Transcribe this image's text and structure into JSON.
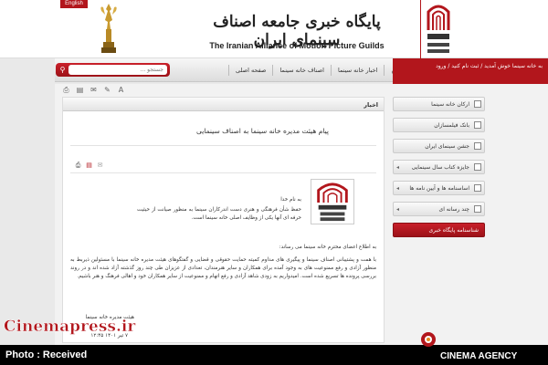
{
  "header": {
    "english_label": "English",
    "title_fa": "پایگاه خبری جامعه اصناف سینمای ایران",
    "title_en": "The Iranian Alliance of Motion Picture Guilds"
  },
  "nav": {
    "search_placeholder": "جستجو ...",
    "items": [
      "صفحه اصلی",
      "اصناف خانه سینما",
      "اخبار خانه سینما",
      "عکس"
    ],
    "welcome_text": "به خانه سینما خوش آمدید / ثبت نام کنید / ورود"
  },
  "content": {
    "section_label": "اخبار",
    "article_title": "پیام هیئت مدیره خانه سینما به اصناف سینمایی",
    "intro_heading": "به نام خدا",
    "intro_text": "حفظ شأن فرهنگی و هنری دست اندرکاران سینما به منظور صیانت از حیثیت حرفه ای آنها یکی از وظایف اصلی خانه سینما است.",
    "notice_heading": "به اطلاع اعضای محترم خانه سینما می رساند:",
    "body_text": "با همت و پشتیبانی اصناف سینما و پیگیری های مداوم کمیته حمایت حقوقی و قضایی و گفتگوهای هیئت مدیره خانه سینما با مسئولین ذیربط به منظور آزادی و رفع ممنوعیت های به وجود آمده برای همکاران و سایر هنرمندان، تعدادی از عزیزان طی چند روز گذشته آزاد شده اند و در روند بررسی پرونده ها تسریع شده است. امیدواریم به زودی شاهد آزادی و رفع اتهام و ممنوعیت از سایر همکاران خود و اهالی فرهنگ و هنر باشیم.",
    "signature": "هیئت مدیره خانه سینما",
    "date": "۷ تیر ۱۴۰۱ ۱۲:۴۵"
  },
  "sidebar": {
    "items": [
      "ارکان خانه سینما",
      "بانک فیلمسازان",
      "جشن سینمای ایران",
      "جایزه کتاب سال سینمایی",
      "اساسنامه ها و آیین نامه ها",
      "چند رسانه ای",
      "شناسنامه پایگاه خبری"
    ]
  },
  "watermark": {
    "site": "Cinemapress.ir",
    "photo_credit": "Photo : Received",
    "agency": "CINEMA AGENCY"
  },
  "colors": {
    "brand_red": "#b2161c",
    "background": "#e9e9e9"
  }
}
